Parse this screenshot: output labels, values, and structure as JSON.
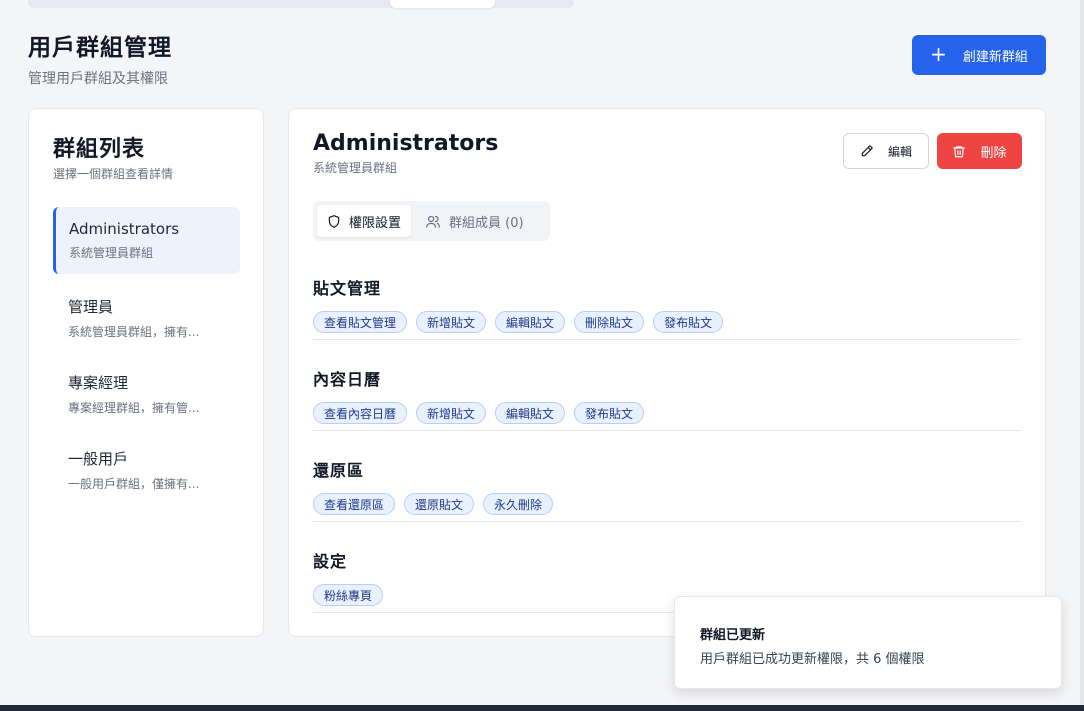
{
  "header": {
    "title": "用戶群組管理",
    "subtitle": "管理用戶群組及其權限",
    "create_label": "創建新群組"
  },
  "sidebar": {
    "title": "群組列表",
    "subtitle": "選擇一個群組查看詳情",
    "groups": [
      {
        "name": "Administrators",
        "desc": "系統管理員群組",
        "active": true
      },
      {
        "name": "管理員",
        "desc": "系統管理員群組，擁有..."
      },
      {
        "name": "專案經理",
        "desc": "專案經理群組，擁有管..."
      },
      {
        "name": "一般用戶",
        "desc": "一般用戶群組，僅擁有..."
      }
    ]
  },
  "detail": {
    "title": "Administrators",
    "subtitle": "系統管理員群組",
    "edit_label": "編輯",
    "delete_label": "刪除",
    "tabs": [
      {
        "label": "權限設置",
        "icon": "shield-icon",
        "active": true
      },
      {
        "label": "群組成員 (0)",
        "icon": "users-icon"
      }
    ],
    "sections": [
      {
        "title": "貼文管理",
        "tags": [
          "查看貼文管理",
          "新增貼文",
          "編輯貼文",
          "刪除貼文",
          "發布貼文"
        ]
      },
      {
        "title": "內容日曆",
        "tags": [
          "查看內容日曆",
          "新增貼文",
          "編輯貼文",
          "發布貼文"
        ]
      },
      {
        "title": "還原區",
        "tags": [
          "查看還原區",
          "還原貼文",
          "永久刪除"
        ]
      },
      {
        "title": "設定",
        "tags": [
          "粉絲專頁"
        ]
      }
    ]
  },
  "toast": {
    "title": "群組已更新",
    "message": "用戶群組已成功更新權限，共 6 個權限"
  },
  "colors": {
    "primary": "#2563eb",
    "danger": "#ef4444",
    "tag_bg": "#eaf1fe",
    "tag_border": "#b9cef5",
    "active_item_bg": "#eef2fc"
  }
}
